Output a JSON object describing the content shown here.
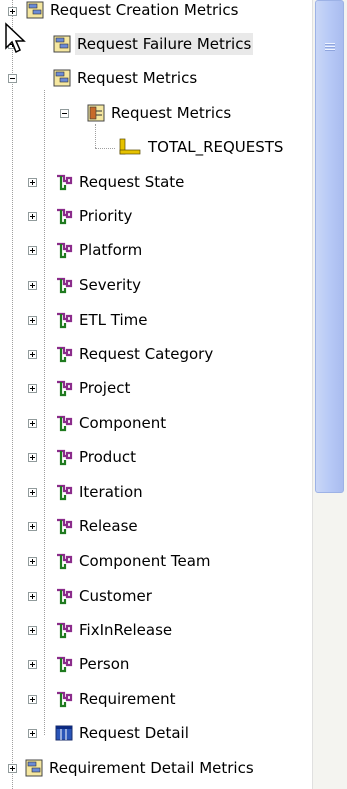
{
  "tree": {
    "nodes": [
      {
        "label": "Request Creation Metrics",
        "icon": "attribute-folder-icon",
        "name": "tree-item-request-creation-metrics",
        "expander": "plus"
      },
      {
        "label": "Request Failure Metrics",
        "icon": "attribute-folder-icon",
        "name": "tree-item-request-failure-metrics",
        "expander": "plus"
      },
      {
        "label": "Request Metrics",
        "icon": "attribute-folder-icon",
        "name": "tree-item-request-metrics",
        "expander": "minus"
      },
      {
        "label": "Request Metrics",
        "icon": "fact-table-icon",
        "name": "tree-item-request-metrics-table",
        "expander": "minus"
      },
      {
        "label": "TOTAL_REQUESTS",
        "icon": "measure-icon",
        "name": "tree-item-total-requests",
        "expander": "none"
      },
      {
        "label": "Request State",
        "icon": "dimension-icon",
        "name": "tree-item-request-state",
        "expander": "plus"
      },
      {
        "label": "Priority",
        "icon": "dimension-icon",
        "name": "tree-item-priority",
        "expander": "plus"
      },
      {
        "label": "Platform",
        "icon": "dimension-icon",
        "name": "tree-item-platform",
        "expander": "plus"
      },
      {
        "label": "Severity",
        "icon": "dimension-icon",
        "name": "tree-item-severity",
        "expander": "plus"
      },
      {
        "label": "ETL Time",
        "icon": "dimension-icon",
        "name": "tree-item-etl-time",
        "expander": "plus"
      },
      {
        "label": "Request Category",
        "icon": "dimension-icon",
        "name": "tree-item-request-category",
        "expander": "plus"
      },
      {
        "label": "Project",
        "icon": "dimension-icon",
        "name": "tree-item-project",
        "expander": "plus"
      },
      {
        "label": "Component",
        "icon": "dimension-icon",
        "name": "tree-item-component",
        "expander": "plus"
      },
      {
        "label": "Product",
        "icon": "dimension-icon",
        "name": "tree-item-product",
        "expander": "plus"
      },
      {
        "label": "Iteration",
        "icon": "dimension-icon",
        "name": "tree-item-iteration",
        "expander": "plus"
      },
      {
        "label": "Release",
        "icon": "dimension-icon",
        "name": "tree-item-release",
        "expander": "plus"
      },
      {
        "label": "Component Team",
        "icon": "dimension-icon",
        "name": "tree-item-component-team",
        "expander": "plus"
      },
      {
        "label": "Customer",
        "icon": "dimension-icon",
        "name": "tree-item-customer",
        "expander": "plus"
      },
      {
        "label": "FixInRelease",
        "icon": "dimension-icon",
        "name": "tree-item-fixinrelease",
        "expander": "plus"
      },
      {
        "label": "Person",
        "icon": "dimension-icon",
        "name": "tree-item-person",
        "expander": "plus"
      },
      {
        "label": "Requirement",
        "icon": "dimension-icon",
        "name": "tree-item-requirement",
        "expander": "plus"
      },
      {
        "label": "Request Detail",
        "icon": "detail-table-icon",
        "name": "tree-item-request-detail",
        "expander": "plus"
      },
      {
        "label": "Requirement Detail Metrics",
        "icon": "attribute-folder-icon",
        "name": "tree-item-requirement-detail-metrics",
        "expander": "plus"
      }
    ]
  },
  "colors": {
    "folder_icon": "#c8a400",
    "dimension_icon_purple": "#8b2c8b",
    "dimension_icon_green": "#1f7a1f",
    "measure_icon": "#d9b400",
    "scrollbar_thumb": "#b7c9f6"
  }
}
